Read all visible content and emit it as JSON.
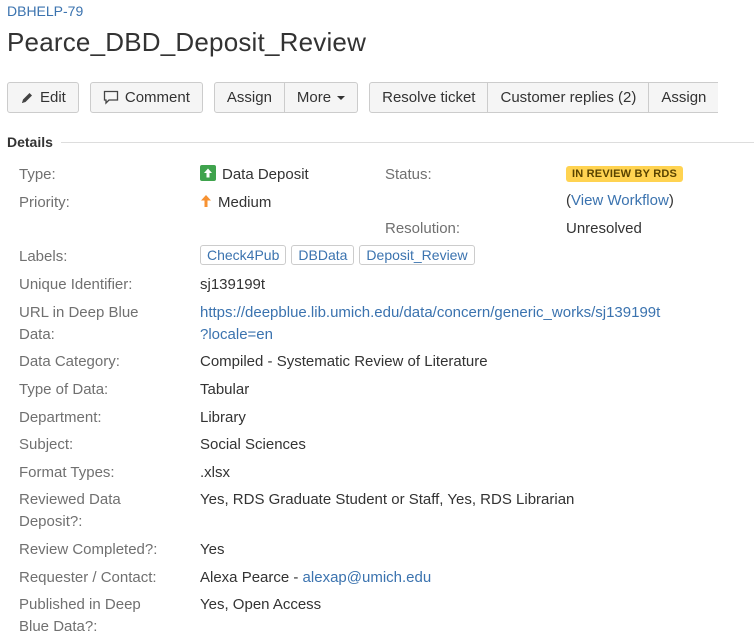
{
  "issue": {
    "key": "DBHELP-79",
    "title": "Pearce_DBD_Deposit_Review"
  },
  "toolbar": {
    "edit": "Edit",
    "comment": "Comment",
    "assign": "Assign",
    "more": "More",
    "resolve": "Resolve ticket",
    "customer_replies": "Customer replies (2)",
    "assign_cut": "Assign"
  },
  "details": {
    "heading": "Details",
    "type_label": "Type:",
    "type_value": "Data Deposit",
    "priority_label": "Priority:",
    "priority_value": "Medium",
    "status_label": "Status:",
    "status_value": "IN REVIEW BY RDS",
    "view_workflow_open": "(",
    "view_workflow": "View Workflow",
    "view_workflow_close": ")",
    "resolution_label": "Resolution:",
    "resolution_value": "Unresolved",
    "labels_label": "Labels:",
    "labels": [
      "Check4Pub",
      "DBData",
      "Deposit_Review"
    ],
    "uid_label": "Unique Identifier:",
    "uid_value": "sj139199t",
    "url_label_1": "URL in Deep Blue",
    "url_label_2": "Data:",
    "url_value_1": "https://deepblue.lib.umich.edu/data/concern/generic_works/sj139199t",
    "url_value_2": "?locale=en",
    "category_label": "Data Category:",
    "category_value": "Compiled - Systematic Review of Literature",
    "typedata_label": "Type of Data:",
    "typedata_value": "Tabular",
    "dept_label": "Department:",
    "dept_value": "Library",
    "subject_label": "Subject:",
    "subject_value": "Social Sciences",
    "format_label": "Format Types:",
    "format_value": ".xlsx",
    "reviewed_label_1": "Reviewed Data",
    "reviewed_label_2": "Deposit?:",
    "reviewed_value": "Yes, RDS Graduate Student or Staff, Yes, RDS Librarian",
    "completed_label": "Review Completed?:",
    "completed_value": "Yes",
    "requester_label": "Requester / Contact:",
    "requester_name": "Alexa Pearce - ",
    "requester_email": "alexap@umich.edu",
    "published_label_1": "Published in Deep",
    "published_label_2": "Blue Data?:",
    "published_value": "Yes, Open Access"
  },
  "colors": {
    "link": "#3b73af",
    "status_lozenge": "#ffd351",
    "type_icon": "#3fa34d",
    "priority_icon": "#f79232"
  },
  "icons": {
    "edit": "pencil-icon",
    "comment": "speech-bubble-icon",
    "type": "data-deposit-icon",
    "priority": "arrow-up-icon"
  }
}
